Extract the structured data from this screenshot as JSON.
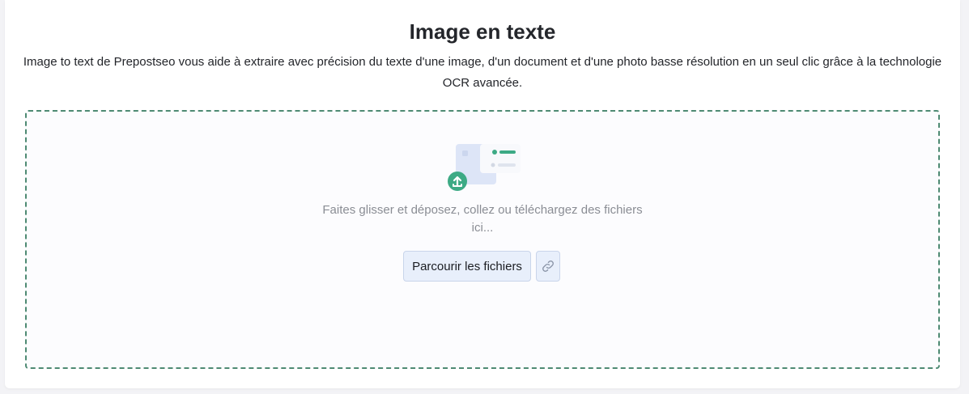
{
  "header": {
    "title": "Image en texte",
    "description": "Image to text de Prepostseo vous aide à extraire avec précision du texte d'une image, d'un document et d'une photo basse résolution en un seul clic grâce à la technologie OCR avancée."
  },
  "dropzone": {
    "instruction": "Faites glisser et déposez, collez  ou téléchargez des fichiers ici...",
    "browse_label": "Parcourir les fichiers",
    "link_icon": "link-icon",
    "upload_icon": "upload-icon"
  },
  "colors": {
    "accent_green": "#3daa85",
    "dashed_border": "#4e8a73",
    "button_bg": "#e8effb",
    "illustration_blue": "#dde5f7"
  }
}
